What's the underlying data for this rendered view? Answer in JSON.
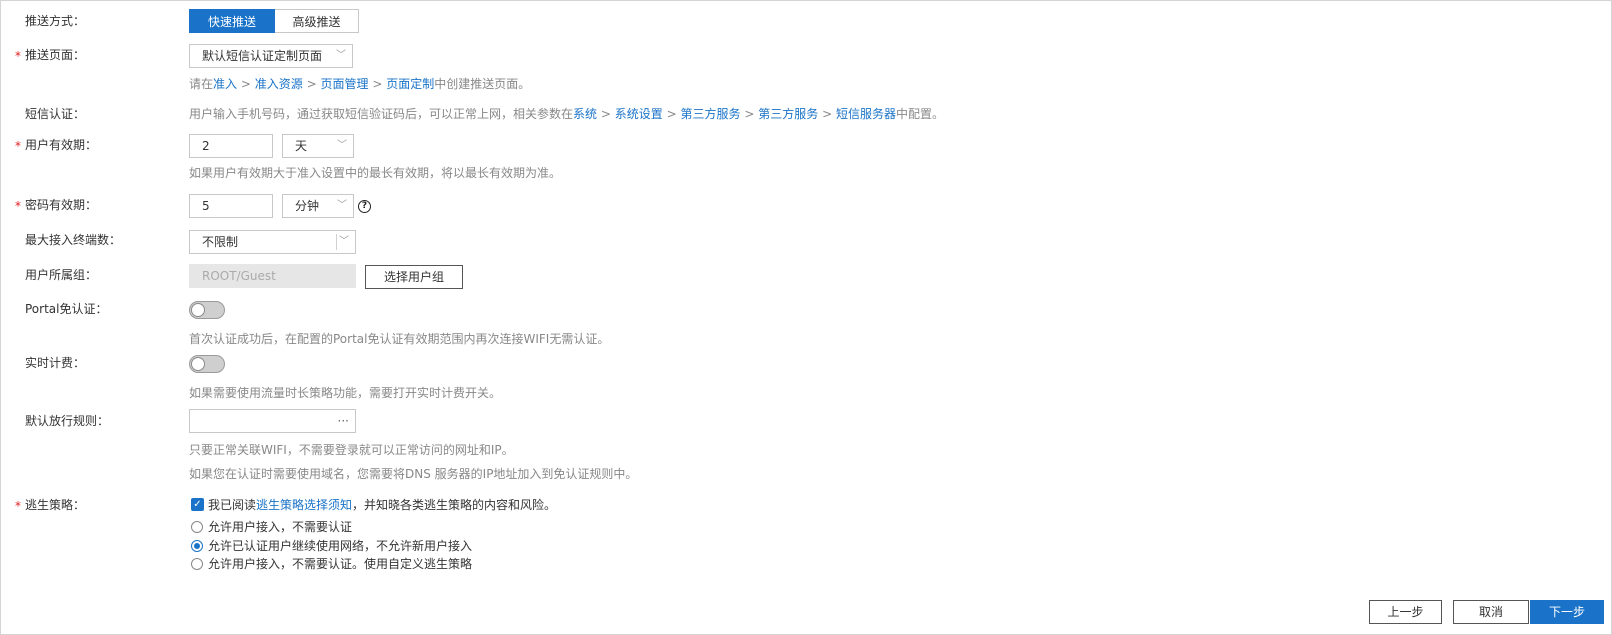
{
  "push_method": {
    "label": "推送方式：",
    "options": [
      "快速推送",
      "高级推送"
    ],
    "selected": "快速推送"
  },
  "push_page": {
    "required": "*",
    "label": "推送页面：",
    "value": "默认短信认证定制页面",
    "hint_prefix": "请在",
    "path": [
      "准入",
      "准入资源",
      "页面管理",
      "页面定制"
    ],
    "separator": ">",
    "hint_suffix": "中创建推送页面。"
  },
  "sms_auth": {
    "label": "短信认证：",
    "hint_prefix": "用户输入手机号码，通过获取短信验证码后，可以正常上网，相关参数在",
    "path": [
      "系统",
      "系统设置",
      "第三方服务",
      "第三方服务",
      "短信服务器"
    ],
    "separator": ">",
    "hint_suffix": "中配置。"
  },
  "user_validity": {
    "required": "*",
    "label": "用户有效期：",
    "value": "2",
    "unit": "天",
    "hint": "如果用户有效期大于准入设置中的最长有效期，将以最长有效期为准。"
  },
  "password_validity": {
    "required": "*",
    "label": "密码有效期：",
    "value": "5",
    "unit": "分钟",
    "help_glyph": "?"
  },
  "max_terminals": {
    "label": "最大接入终端数：",
    "value": "不限制"
  },
  "user_group": {
    "label": "用户所属组：",
    "value": "ROOT/Guest",
    "button": "选择用户组"
  },
  "portal_free_auth": {
    "label": "Portal免认证：",
    "enabled": false,
    "hint": "首次认证成功后，在配置的Portal免认证有效期范围内再次连接WIFI无需认证。"
  },
  "realtime_billing": {
    "label": "实时计费：",
    "enabled": false,
    "hint": "如果需要使用流量时长策略功能，需要打开实时计费开关。"
  },
  "default_release_rule": {
    "label": "默认放行规则：",
    "value": "",
    "more_glyph": "···",
    "hint1": "只要正常关联WIFI，不需要登录就可以正常访问的网址和IP。",
    "hint2": "如果您在认证时需要使用域名，您需要将DNS 服务器的IP地址加入到免认证规则中。"
  },
  "escape_policy": {
    "required": "*",
    "label": "逃生策略：",
    "agree_prefix": "我已阅读",
    "agree_link": "逃生策略选择须知",
    "agree_suffix": "，并知晓各类逃生策略的内容和风险。",
    "agreed": true,
    "check_glyph": "✓",
    "options": [
      "允许用户接入，不需要认证",
      "允许已认证用户继续使用网络，不允许新用户接入",
      "允许用户接入，不需要认证。使用自定义逃生策略"
    ],
    "selected_index": 1
  },
  "footer": {
    "prev": "上一步",
    "cancel": "取消",
    "next": "下一步"
  },
  "colors": {
    "accent": "#1a73c8",
    "required": "#e02020",
    "hint": "#888888"
  }
}
